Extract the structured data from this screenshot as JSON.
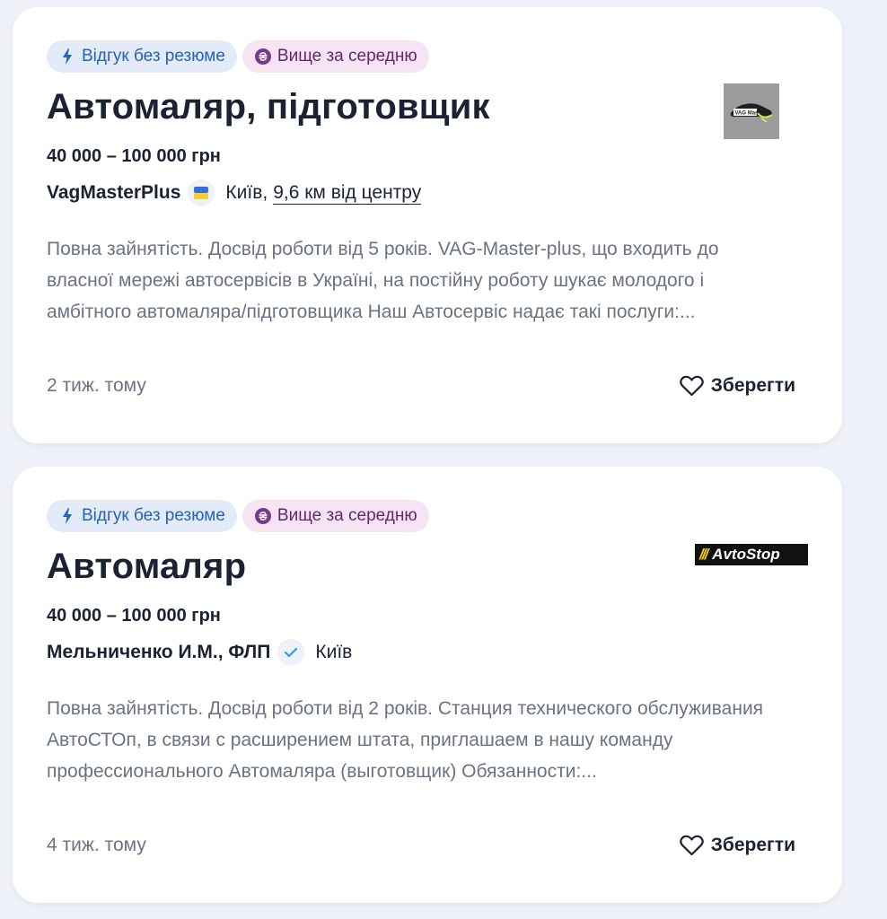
{
  "vacancies": [
    {
      "tags": [
        {
          "icon": "lightning-icon",
          "label": "Відгук без резюме"
        },
        {
          "icon": "hryvnia-icon",
          "label": "Вище за середню"
        }
      ],
      "title": "Автомаляр, підготовщик",
      "salary": "40 000 – 100 000 грн",
      "company": "VagMasterPlus",
      "company_badge": "ukraine-flag-icon",
      "city": "Київ,",
      "distance": "9,6 км від центру",
      "description": "Повна зайнятість. Досвід роботи від 5 років. VAG-Master-plus, що входить до власної мережі автосервісів в Україні, на постійну роботу шукає молодого і амбітного автомаляра/підготовщика Наш Автосервіс надає такі послуги:...",
      "posted": "2 тиж. тому",
      "save_label": "Зберегти",
      "logo_text": "VAG Master"
    },
    {
      "tags": [
        {
          "icon": "lightning-icon",
          "label": "Відгук без резюме"
        },
        {
          "icon": "hryvnia-icon",
          "label": "Вище за середню"
        }
      ],
      "title": "Автомаляр",
      "salary": "40 000 – 100 000 грн",
      "company": "Мельниченко И.М., ФЛП",
      "company_badge": "verified-check-icon",
      "city": "Київ",
      "description": "Повна зайнятість. Досвід роботи від 2 років. Станция технического обслуживания АвтоСТОп, в связи с расширением штата, приглашаем в нашу команду профессионального Автомаляра (выготовщик) Обязанности:...",
      "posted": "4 тиж. тому",
      "save_label": "Зберегти",
      "logo_text": "AvtoStop"
    }
  ],
  "colors": {
    "page_bg": "#eef1f7",
    "tag_blue_bg": "#e3ebf9",
    "tag_blue_text": "#2562b6",
    "tag_purple_bg": "#f6e4f5",
    "tag_purple_text": "#5c2a6b",
    "title": "#1a2233",
    "muted_text": "#6b7382"
  }
}
